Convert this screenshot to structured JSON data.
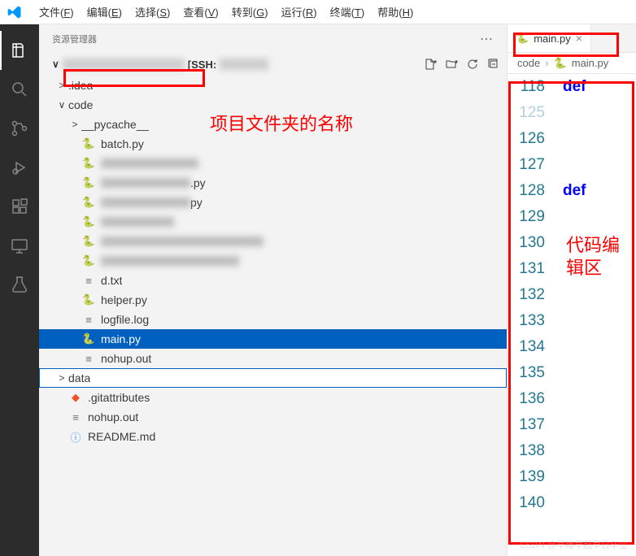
{
  "menubar": {
    "items": [
      {
        "label": "文件",
        "key": "F"
      },
      {
        "label": "编辑",
        "key": "E"
      },
      {
        "label": "选择",
        "key": "S"
      },
      {
        "label": "查看",
        "key": "V"
      },
      {
        "label": "转到",
        "key": "G"
      },
      {
        "label": "运行",
        "key": "R"
      },
      {
        "label": "终端",
        "key": "T"
      },
      {
        "label": "帮助",
        "key": "H"
      }
    ]
  },
  "sidebar": {
    "title": "资源管理器",
    "workspace_suffix": "[SSH:"
  },
  "tree": [
    {
      "indent": 1,
      "type": "folder",
      "chev": ">",
      "label": ".idea"
    },
    {
      "indent": 1,
      "type": "folder-open",
      "chev": "∨",
      "label": "code"
    },
    {
      "indent": 2,
      "type": "folder",
      "chev": ">",
      "label": "__pycache__"
    },
    {
      "indent": 2,
      "type": "py",
      "label": "batch.py"
    },
    {
      "indent": 2,
      "type": "py",
      "label": "",
      "blurred": true,
      "blurW": 120
    },
    {
      "indent": 2,
      "type": "py",
      "label": ".py",
      "blurred": true,
      "blurW": 110
    },
    {
      "indent": 2,
      "type": "py",
      "label": "py",
      "blurred": true,
      "blurW": 110
    },
    {
      "indent": 2,
      "type": "py",
      "label": "",
      "blurred": true,
      "blurW": 90
    },
    {
      "indent": 2,
      "type": "py",
      "label": "",
      "blurred": true,
      "blurW": 200
    },
    {
      "indent": 2,
      "type": "py",
      "label": "",
      "blurred": true,
      "blurW": 170
    },
    {
      "indent": 2,
      "type": "txt",
      "label": "d.txt"
    },
    {
      "indent": 2,
      "type": "py",
      "label": "helper.py"
    },
    {
      "indent": 2,
      "type": "txt",
      "label": "logfile.log"
    },
    {
      "indent": 2,
      "type": "py",
      "label": "main.py",
      "selected": true
    },
    {
      "indent": 2,
      "type": "txt",
      "label": "nohup.out"
    },
    {
      "indent": 1,
      "type": "folder",
      "chev": ">",
      "label": "data",
      "focused": true
    },
    {
      "indent": 1,
      "type": "git",
      "label": ".gitattributes"
    },
    {
      "indent": 1,
      "type": "txt",
      "label": "nohup.out"
    },
    {
      "indent": 1,
      "type": "info",
      "label": "README.md"
    }
  ],
  "tabs": {
    "active": {
      "label": "main.py"
    }
  },
  "breadcrumb": {
    "parts": [
      "code",
      "main.py"
    ]
  },
  "code": {
    "lines": [
      {
        "n": 118,
        "kw": "def"
      },
      {
        "n": 125,
        "faded": true
      },
      {
        "n": 126
      },
      {
        "n": 127
      },
      {
        "n": 128,
        "kw": "def"
      },
      {
        "n": 129
      },
      {
        "n": 130
      },
      {
        "n": 131
      },
      {
        "n": 132
      },
      {
        "n": 133
      },
      {
        "n": 134
      },
      {
        "n": 135
      },
      {
        "n": 136
      },
      {
        "n": 137
      },
      {
        "n": 138
      },
      {
        "n": 139
      },
      {
        "n": 140
      }
    ]
  },
  "annotations": {
    "project_name_label": "项目文件夹的名称",
    "code_area_label": "代码编辑区"
  },
  "watermark": "CSDN @早睡早起早日毕业"
}
